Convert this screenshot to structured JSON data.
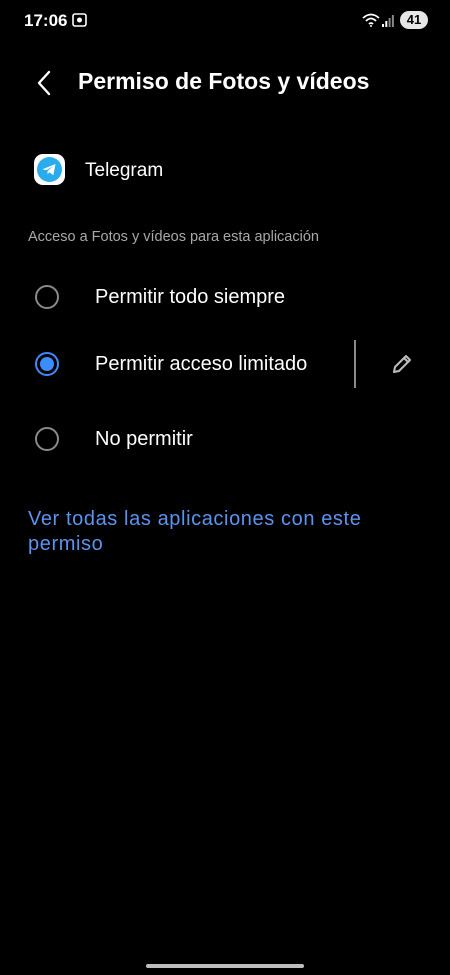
{
  "status_bar": {
    "time": "17:06",
    "battery": "41",
    "icons": [
      "screenshot-icon",
      "wifi-icon",
      "signal-icon",
      "battery-icon"
    ]
  },
  "header": {
    "back_icon": "chevron-left-icon",
    "title": "Permiso de Fotos y vídeos"
  },
  "app": {
    "name": "Telegram",
    "icon": "telegram-icon",
    "brand_color": "#2AABEE"
  },
  "section_label": "Acceso a Fotos y vídeos para esta aplicación",
  "options": [
    {
      "label": "Permitir todo siempre",
      "selected": false
    },
    {
      "label": "Permitir acceso limitado",
      "selected": true,
      "edit_icon": "pencil-icon"
    },
    {
      "label": "No permitir",
      "selected": false
    }
  ],
  "link": "Ver todas las aplicaciones con este permiso",
  "colors": {
    "background": "#000000",
    "accent": "#3E8BFF",
    "link": "#5B93F0",
    "secondary_text": "#A8A8A8"
  }
}
